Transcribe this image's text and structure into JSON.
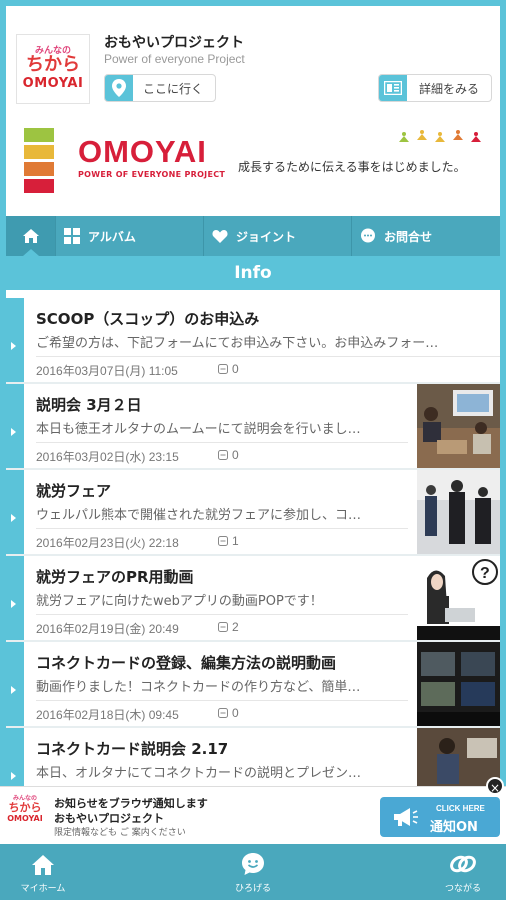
{
  "header": {
    "logo": {
      "top": "みんなの",
      "mid": "ちから",
      "bottom": "OMOYAI"
    },
    "app_name": "おもやいプロジェクト",
    "app_sub": "Power of everyone Project",
    "goto_label": "ここに行く",
    "detail_label": "詳細をみる"
  },
  "banner": {
    "brand": "OMOYAI",
    "brand_sub": "POWER OF EVERYONE PROJECT",
    "tagline": "成長するために伝える事をはじめました。",
    "stripe_colors": [
      "#9dc441",
      "#e8b83a",
      "#e07a35",
      "#d71f3a"
    ]
  },
  "nav": {
    "album": "アルバム",
    "joint": "ジョイント",
    "contact": "お問合せ"
  },
  "section_title": "Info",
  "posts": [
    {
      "title": "SCOOP（スコップ）のお申込み",
      "excerpt": "ご希望の方は、下記フォームにてお申込み下さい。お申込みフォー…",
      "date": "2016年03月07日(月) 11:05",
      "comments": "0"
    },
    {
      "title": "説明会 3月２日",
      "excerpt": "本日も徳王オルタナのムームーにて説明会を行いまし…",
      "date": "2016年03月02日(水) 23:15",
      "comments": "0"
    },
    {
      "title": "就労フェア",
      "excerpt": "ウェルパル熊本で開催された就労フェアに参加し、コ…",
      "date": "2016年02月23日(火) 22:18",
      "comments": "1"
    },
    {
      "title": "就労フェアのPR用動画",
      "excerpt": "就労フェアに向けたwebアプリの動画POPです！",
      "date": "2016年02月19日(金) 20:49",
      "comments": "2"
    },
    {
      "title": "コネクトカードの登録、編集方法の説明動画",
      "excerpt": "動画作りました！コネクトカードの作り方など、簡単…",
      "date": "2016年02月18日(木) 09:45",
      "comments": "0"
    },
    {
      "title": "コネクトカード説明会 2.17",
      "excerpt": "本日、オルタナにてコネクトカードの説明とプレゼン…",
      "date": "",
      "comments": ""
    }
  ],
  "notification": {
    "line1": "お知らせをブラウザ通知します",
    "line2": "おもやいプロジェクト",
    "line3": "限定情報なども ご 案内ください",
    "btn_small": "CLICK HERE",
    "btn_main": "通知ON",
    "close": "×"
  },
  "tabbar": {
    "home": "マイホーム",
    "hiroba": "ひろげる",
    "tsunagaru": "つながる"
  },
  "colors": {
    "accent": "#5bc3d9",
    "nav": "#4aa8bd",
    "brand_red": "#d71f3a"
  }
}
